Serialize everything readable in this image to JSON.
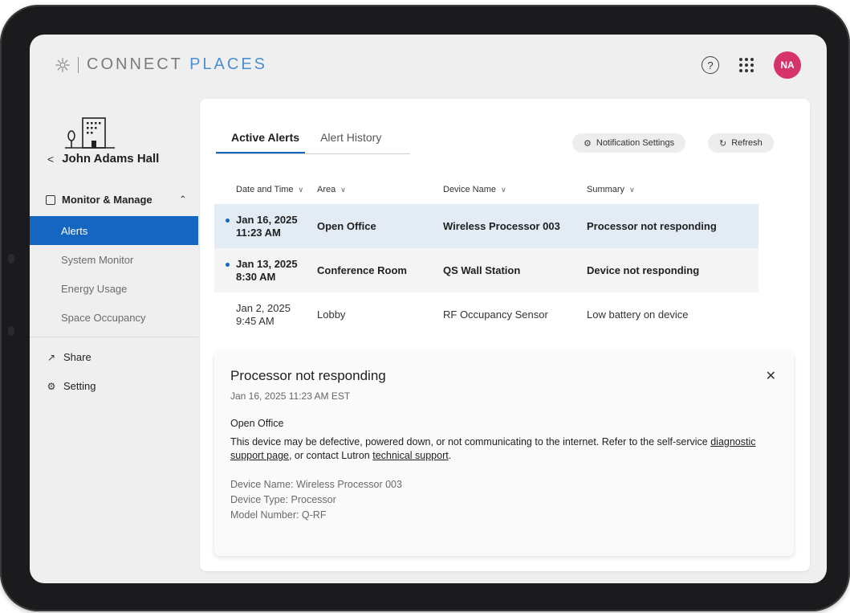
{
  "brand": {
    "name_plain": "CONNECT ",
    "name_accent": "PLACES"
  },
  "header": {
    "help_glyph": "?",
    "avatar_initials": "NA",
    "avatar_color": "#d6336c"
  },
  "sidebar": {
    "building_name": "John Adams Hall",
    "back_glyph": "<",
    "section_label": "Monitor & Manage",
    "items": [
      {
        "label": "Alerts",
        "active": true
      },
      {
        "label": "System Monitor",
        "active": false
      },
      {
        "label": "Energy Usage",
        "active": false
      },
      {
        "label": "Space Occupancy",
        "active": false
      }
    ],
    "share_label": "Share",
    "setting_label": "Setting"
  },
  "tabs": [
    {
      "label": "Active Alerts",
      "active": true
    },
    {
      "label": "Alert History",
      "active": false
    }
  ],
  "buttons": {
    "notification_settings": "Notification Settings",
    "refresh": "Refresh"
  },
  "table": {
    "columns": [
      "Date and Time",
      "Area",
      "Device Name",
      "Summary"
    ],
    "rows": [
      {
        "date": "Jan 16, 2025",
        "time": "11:23 AM",
        "area": "Open Office",
        "device": "Wireless Processor 003",
        "summary": "Processor not responding",
        "unread": true,
        "selected": true
      },
      {
        "date": "Jan 13, 2025",
        "time": "8:30 AM",
        "area": "Conference Room",
        "device": "QS Wall Station",
        "summary": "Device not responding",
        "unread": true,
        "selected": false
      },
      {
        "date": "Jan 2, 2025",
        "time": "9:45 AM",
        "area": "Lobby",
        "device": "RF Occupancy Sensor",
        "summary": "Low battery on device",
        "unread": false,
        "selected": false
      }
    ]
  },
  "detail": {
    "title": "Processor not responding",
    "timestamp": "Jan 16, 2025 11:23 AM EST",
    "area": "Open Office",
    "desc_part1": "This device may be defective, powered down, or not communicating to the internet. Refer to the self-service ",
    "link1": "diagnostic support page",
    "desc_part2": ", or contact Lutron ",
    "link2": "technical support",
    "desc_part3": ".",
    "device_name": "Device Name: Wireless Processor 003",
    "device_type": "Device Type:  Processor",
    "model_number": "Model Number:  Q-RF"
  },
  "colors": {
    "accent": "#1466c0",
    "selected_row": "#e3ebf5",
    "logo_accent": "#4a8fd0"
  }
}
